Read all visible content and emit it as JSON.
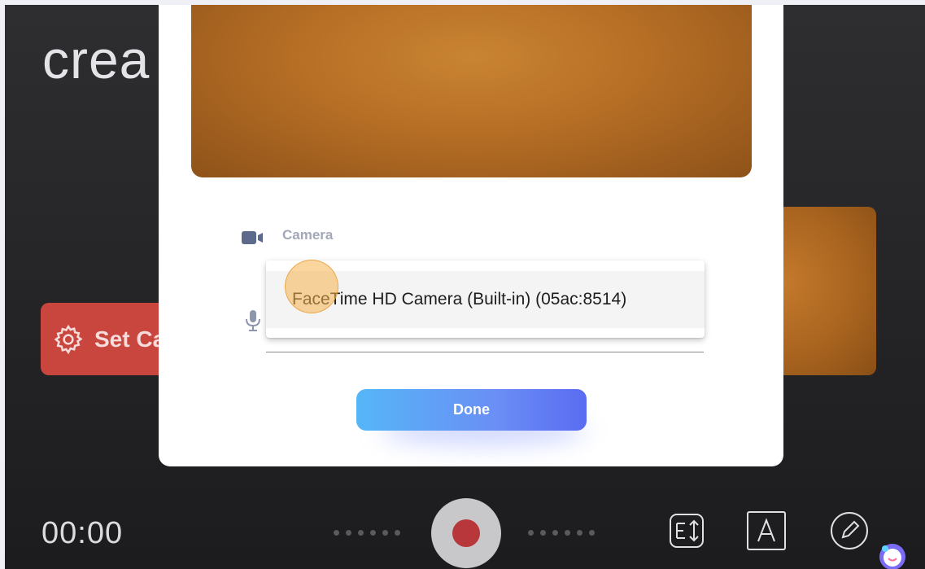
{
  "background": {
    "title_fragment": "crea",
    "set_button_label": "Set Ca",
    "timer": "00:00"
  },
  "modal": {
    "camera_label": "Camera",
    "dropdown_options": [
      "FaceTime HD Camera (Built-in) (05ac:8514)"
    ],
    "done_label": "Done"
  },
  "icons": {
    "camera": "video-camera-icon",
    "mic": "microphone-icon",
    "gear": "gear-icon",
    "teleprompter": "text-scroll-icon",
    "text": "text-a-icon",
    "draw": "pen-circle-icon",
    "mascot": "assistant-mascot-icon"
  },
  "colors": {
    "record_red": "#b8373a",
    "set_button_red": "#c9463e",
    "done_gradient_start": "#55b6f7",
    "done_gradient_end": "#5a6cf2",
    "label_gray": "#a3a8b7"
  }
}
